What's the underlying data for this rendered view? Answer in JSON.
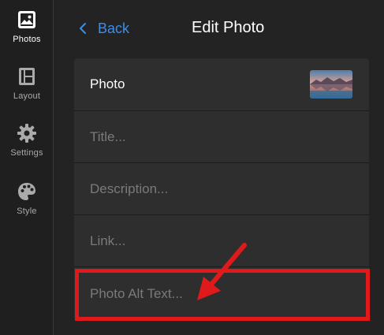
{
  "sidebar": {
    "items": [
      {
        "label": "Photos",
        "icon": "photo-icon",
        "active": true
      },
      {
        "label": "Layout",
        "icon": "layout-icon",
        "active": false
      },
      {
        "label": "Settings",
        "icon": "gear-icon",
        "active": false
      },
      {
        "label": "Style",
        "icon": "palette-icon",
        "active": false
      }
    ]
  },
  "header": {
    "back_label": "Back",
    "title": "Edit Photo"
  },
  "form": {
    "photo_label": "Photo",
    "title_placeholder": "Title...",
    "description_placeholder": "Description...",
    "link_placeholder": "Link...",
    "alt_text_placeholder": "Photo Alt Text..."
  },
  "colors": {
    "accent": "#3b8eea",
    "highlight": "#e01a1a",
    "background": "#232323",
    "panel": "#2e2e2e"
  }
}
